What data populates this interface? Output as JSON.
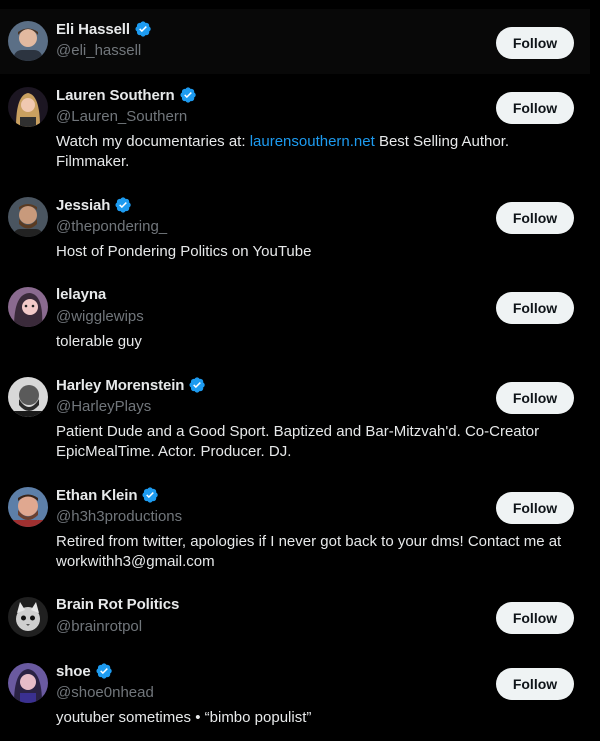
{
  "follow_label": "Follow",
  "colors": {
    "link": "#1d9bf0",
    "verified": "#1d9bf0",
    "handle": "#71767b"
  },
  "accounts": [
    {
      "name": "Eli Hassell",
      "handle": "@eli_hassell",
      "verified": true,
      "bio_pre": "",
      "bio_link": "",
      "bio_post": ""
    },
    {
      "name": "Lauren Southern",
      "handle": "@Lauren_Southern",
      "verified": true,
      "bio_pre": "Watch my documentaries at: ",
      "bio_link": "laurensouthern.net",
      "bio_post": " Best Selling Author. Filmmaker."
    },
    {
      "name": "Jessiah",
      "handle": "@thepondering_",
      "verified": true,
      "bio_pre": "Host of Pondering Politics on YouTube",
      "bio_link": "",
      "bio_post": ""
    },
    {
      "name": "lelayna",
      "handle": "@wigglewips",
      "verified": false,
      "bio_pre": "tolerable guy",
      "bio_link": "",
      "bio_post": ""
    },
    {
      "name": "Harley Morenstein",
      "handle": "@HarleyPlays",
      "verified": true,
      "bio_pre": "Patient Dude and a Good Sport. Baptized and Bar-Mitzvah'd. Co-Creator EpicMealTime. Actor. Producer. DJ.",
      "bio_link": "",
      "bio_post": ""
    },
    {
      "name": "Ethan Klein",
      "handle": "@h3h3productions",
      "verified": true,
      "bio_pre": "Retired from twitter, apologies if I never got back to your dms! Contact me at workwithh3@gmail.com",
      "bio_link": "",
      "bio_post": ""
    },
    {
      "name": "Brain Rot Politics",
      "handle": "@brainrotpol",
      "verified": false,
      "bio_pre": "",
      "bio_link": "",
      "bio_post": ""
    },
    {
      "name": "shoe",
      "handle": "@shoe0nhead",
      "verified": true,
      "bio_pre": "youtuber sometimes • “bimbo populist”",
      "bio_link": "",
      "bio_post": ""
    }
  ]
}
